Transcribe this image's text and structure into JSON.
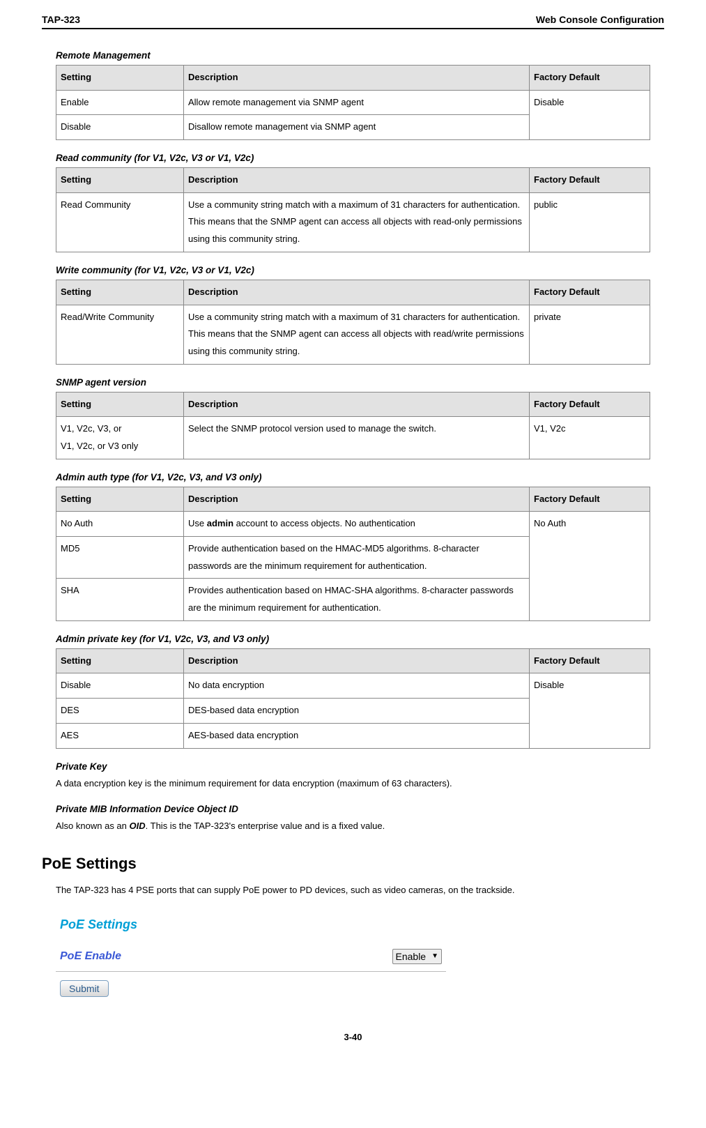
{
  "header": {
    "left": "TAP-323",
    "right": "Web Console Configuration"
  },
  "sections": [
    {
      "heading": "Remote Management",
      "columns": [
        "Setting",
        "Description",
        "Factory Default"
      ],
      "rows": [
        {
          "setting": "Enable",
          "desc": "Allow remote management via SNMP agent",
          "default": "Disable",
          "default_rowspan": 2
        },
        {
          "setting": "Disable",
          "desc": "Disallow remote management via SNMP agent"
        }
      ]
    },
    {
      "heading": "Read community (for V1, V2c, V3 or V1, V2c)",
      "columns": [
        "Setting",
        "Description",
        "Factory Default"
      ],
      "rows": [
        {
          "setting": "Read Community",
          "desc": "Use a community string match with a maximum of 31 characters for authentication. This means that the SNMP agent can access all objects with read-only permissions using this community string.",
          "default": "public"
        }
      ]
    },
    {
      "heading": "Write community (for V1, V2c, V3 or V1, V2c)",
      "columns": [
        "Setting",
        "Description",
        "Factory Default"
      ],
      "rows": [
        {
          "setting": "Read/Write Community",
          "desc": "Use a community string match with a maximum of 31 characters for authentication. This means that the SNMP agent can access all objects with read/write permissions using this community string.",
          "default": "private"
        }
      ]
    },
    {
      "heading": "SNMP agent version",
      "columns": [
        "Setting",
        "Description",
        "Factory Default"
      ],
      "rows": [
        {
          "setting_lines": [
            "V1, V2c, V3, or",
            "V1, V2c, or V3 only"
          ],
          "desc": "Select the SNMP protocol version used to manage the switch.",
          "default": "V1, V2c"
        }
      ]
    },
    {
      "heading": "Admin auth type (for V1, V2c, V3, and V3 only)",
      "columns": [
        "Setting",
        "Description",
        "Factory Default"
      ],
      "rows": [
        {
          "setting": "No Auth",
          "desc_parts": [
            {
              "t": "Use "
            },
            {
              "t": "admin",
              "bold": true
            },
            {
              "t": " account to access objects. No authentication"
            }
          ],
          "default": "No Auth",
          "default_rowspan": 3
        },
        {
          "setting": "MD5",
          "desc": "Provide authentication based on the HMAC-MD5 algorithms. 8-character passwords are the minimum requirement for authentication."
        },
        {
          "setting": "SHA",
          "desc": "Provides authentication based on HMAC-SHA algorithms. 8-character passwords are the minimum requirement for authentication."
        }
      ]
    },
    {
      "heading": "Admin private key (for V1, V2c, V3, and V3 only)",
      "columns": [
        "Setting",
        "Description",
        "Factory Default"
      ],
      "rows": [
        {
          "setting": "Disable",
          "desc": "No data encryption",
          "default": "Disable",
          "default_rowspan": 3
        },
        {
          "setting": "DES",
          "desc": "DES-based data encryption"
        },
        {
          "setting": "AES",
          "desc": "AES-based data encryption"
        }
      ]
    }
  ],
  "private_key": {
    "heading": "Private Key",
    "text": "A data encryption key is the minimum requirement for data encryption (maximum of 63 characters)."
  },
  "private_mib": {
    "heading": "Private MIB Information Device Object ID",
    "prefix": "Also known as an ",
    "bold": "OID",
    "suffix": ". This is the TAP-323's enterprise value and is a fixed value."
  },
  "poe": {
    "heading": "PoE Settings",
    "intro": "The TAP-323 has 4 PSE ports that can supply PoE power to PD devices, such as video cameras, on the trackside.",
    "panel_title": "PoE Settings",
    "field_label": "PoE Enable",
    "field_value": "Enable",
    "submit": "Submit"
  },
  "page_number": "3-40"
}
